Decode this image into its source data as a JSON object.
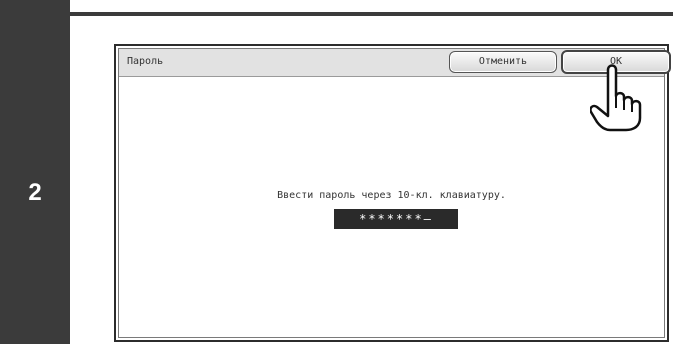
{
  "step": {
    "number": "2"
  },
  "dialog": {
    "title": "Пароль",
    "cancel_label": "Отменить",
    "ok_label": "OK",
    "instruction": "Ввести пароль через 10-кл. клавиатуру.",
    "password_value": "*******—"
  },
  "icons": {
    "pointer": "hand-pointer-icon"
  },
  "colors": {
    "sidebar": "#3b3b3b",
    "password_field": "#2a2a2a",
    "title_bar": "#e2e2e2"
  }
}
